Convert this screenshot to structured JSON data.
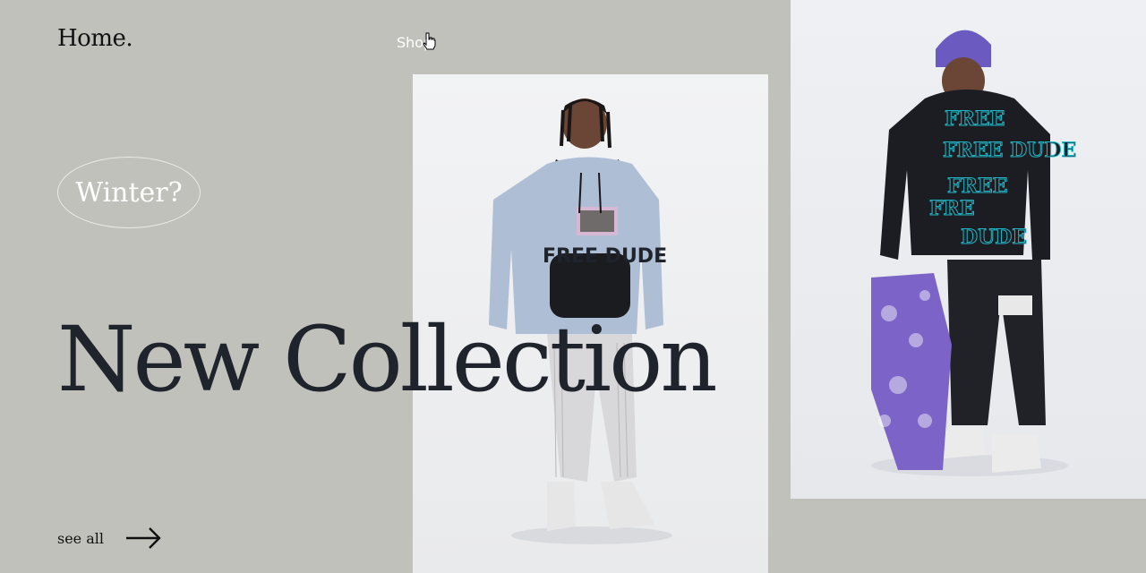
{
  "header": {
    "logo": "Home.",
    "nav_shop": "Shop"
  },
  "badge": {
    "label": "Winter?"
  },
  "hero": {
    "title": "New Collection"
  },
  "cta": {
    "label": "see all"
  },
  "photos": [
    {
      "print_text": "FREE DUDE"
    },
    {
      "print_text": "FREE DUDE"
    }
  ],
  "icons": [
    "hand-pointer-icon",
    "arrow-right-icon"
  ]
}
